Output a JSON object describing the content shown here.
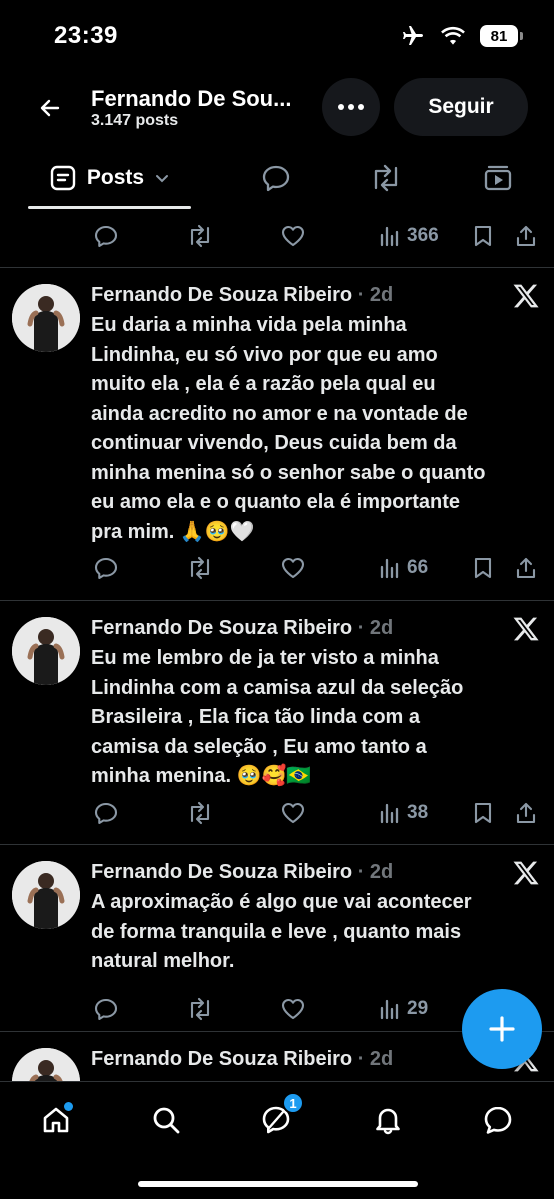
{
  "status_bar": {
    "time": "23:39",
    "battery": "81"
  },
  "header": {
    "title": "Fernando De Sou...",
    "subtitle": "3.147 posts",
    "follow_label": "Seguir"
  },
  "tabs": {
    "posts_label": "Posts"
  },
  "icons": {
    "back": "arrow-left-icon",
    "more": "more-icon",
    "posts": "posts-icon",
    "chevron": "chevron-down-icon",
    "replies": "speech-bubble-icon",
    "reposts": "repost-icon",
    "media": "media-icon",
    "reply": "reply-icon",
    "repost": "repost-icon",
    "like": "heart-icon",
    "views": "views-icon",
    "bookmark": "bookmark-icon",
    "share": "share-icon",
    "x": "x-logo-icon",
    "home": "home-icon",
    "search": "search-icon",
    "grok": "grok-icon",
    "notifications": "bell-icon",
    "messages": "messages-icon"
  },
  "colors": {
    "accent": "#1d9bf0",
    "text": "#e7e9ea",
    "muted": "#71767b"
  },
  "feed": {
    "top_stats": {
      "views": "366"
    },
    "posts": [
      {
        "author": "Fernando De Souza Ribeiro",
        "meta": " · 2d",
        "lines": [
          "Eu daria a minha vida pela minha",
          "Lindinha, eu só vivo por que eu amo",
          "muito ela , ela é a razão pela qual eu",
          "ainda acredito no amor e na vontade de",
          "continuar vivendo, Deus cuida bem da",
          "minha menina só o senhor sabe o quanto",
          "eu amo ela e o quanto ela é importante",
          "pra mim. 🙏🥹🤍"
        ],
        "views": "66"
      },
      {
        "author": "Fernando De Souza Ribeiro",
        "meta": " · 2d",
        "lines": [
          "Eu me lembro de ja ter visto a minha",
          "Lindinha com a camisa azul da seleção",
          "Brasileira , Ela fica tão linda com a",
          "camisa da seleção , Eu amo tanto a",
          "minha menina. 🥹🥰🇧🇷"
        ],
        "views": "38"
      },
      {
        "author": "Fernando De Souza Ribeiro",
        "meta": " · 2d",
        "lines": [
          "A aproximação é algo que vai acontecer",
          "de forma tranquila e leve , quanto mais",
          "natural melhor."
        ],
        "views": "29"
      },
      {
        "author": "Fernando De Souza Ribeiro",
        "meta": " · 2d",
        "lines": [],
        "views": ""
      }
    ]
  },
  "bottom_nav": {
    "grok_badge": "1"
  }
}
